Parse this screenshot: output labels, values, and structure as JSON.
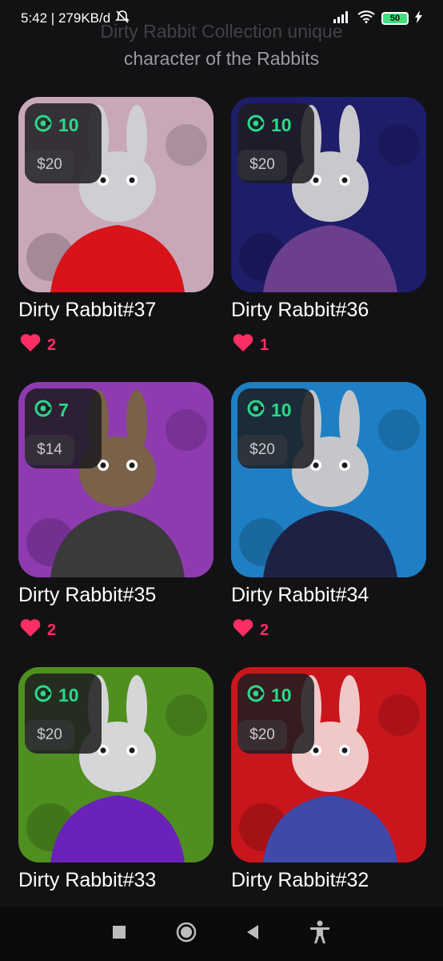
{
  "status_bar": {
    "left_text": "5:42 | 279KB/d",
    "battery": "50"
  },
  "header": {
    "line1": "Dirty Rabbit Collection unique",
    "line2": "character of the Rabbits"
  },
  "cards": [
    {
      "name": "Dirty Rabbit#37",
      "coins": "10",
      "price": "$20",
      "likes": "2",
      "bg": "#c8a8b8",
      "body": "#d8141a",
      "fur": "#cfcfd3"
    },
    {
      "name": "Dirty Rabbit#36",
      "coins": "10",
      "price": "$20",
      "likes": "1",
      "bg": "#1e1d6a",
      "body": "#6b3f8c",
      "fur": "#c9c9cd"
    },
    {
      "name": "Dirty Rabbit#35",
      "coins": "7",
      "price": "$14",
      "likes": "2",
      "bg": "#8e3bb0",
      "body": "#3a3a3a",
      "fur": "#7a6248"
    },
    {
      "name": "Dirty Rabbit#34",
      "coins": "10",
      "price": "$20",
      "likes": "2",
      "bg": "#1f7fc4",
      "body": "#1d2244",
      "fur": "#c4c6ca"
    },
    {
      "name": "Dirty Rabbit#33",
      "coins": "10",
      "price": "$20",
      "likes": "",
      "bg": "#4f8f20",
      "body": "#6a22b8",
      "fur": "#d6d6d8"
    },
    {
      "name": "Dirty Rabbit#32",
      "coins": "10",
      "price": "$20",
      "likes": "",
      "bg": "#c8161c",
      "body": "#4048a8",
      "fur": "#f0c8c8"
    }
  ],
  "icons": {
    "coin": "coin-icon",
    "heart": "heart-icon"
  },
  "colors": {
    "accent_green": "#2bd98a",
    "heart_pink": "#ff2e63",
    "background": "#121214"
  }
}
